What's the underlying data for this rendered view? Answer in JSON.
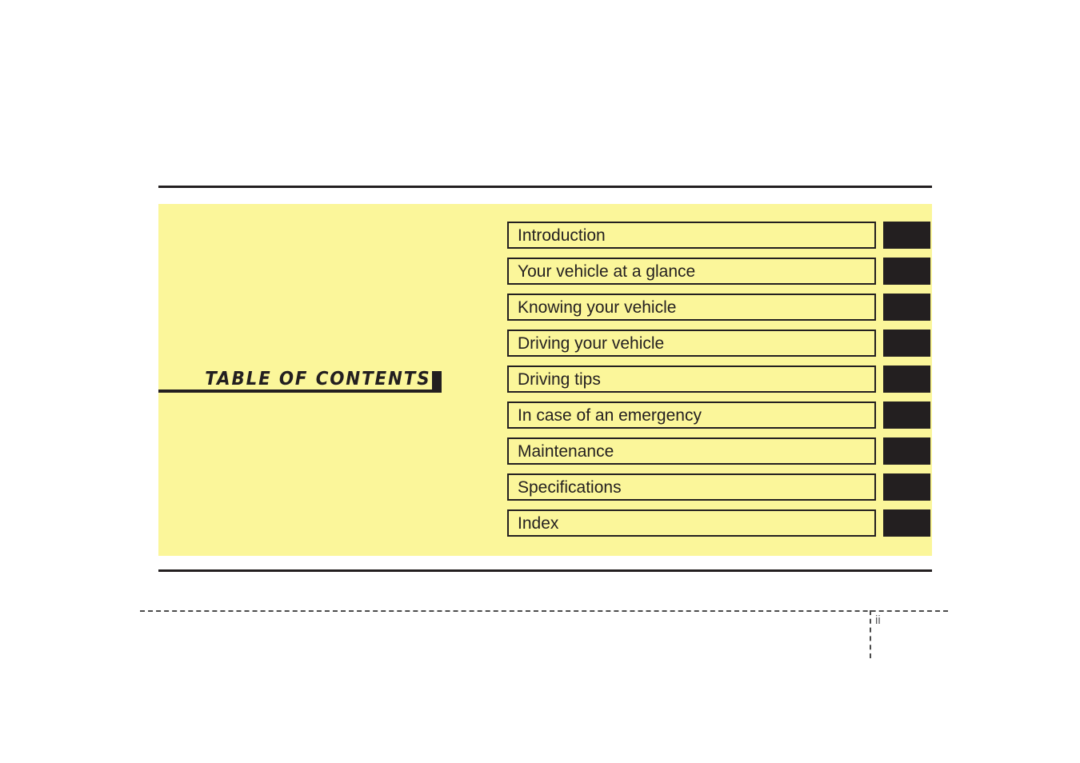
{
  "page": {
    "heading": "TABLE OF CONTENTS",
    "page_number": "ii",
    "panel_color": "#fbf69a",
    "ink_color": "#231f20"
  },
  "contents": {
    "entries": [
      {
        "label": "Introduction"
      },
      {
        "label": "Your vehicle at a glance"
      },
      {
        "label": "Knowing your vehicle"
      },
      {
        "label": "Driving your vehicle"
      },
      {
        "label": "Driving tips"
      },
      {
        "label": "In case of an emergency"
      },
      {
        "label": "Maintenance"
      },
      {
        "label": "Specifications"
      },
      {
        "label": "Index"
      }
    ]
  }
}
